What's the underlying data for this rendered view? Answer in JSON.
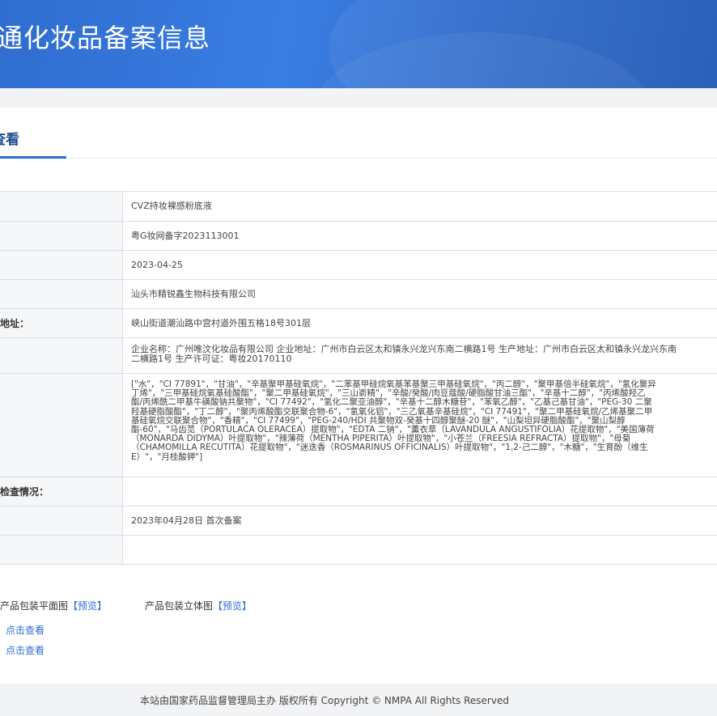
{
  "header": {
    "title": "通化妆品备案信息"
  },
  "tab": {
    "label": "查看"
  },
  "rows": [
    {
      "label": "",
      "value": "CVZ持妆裸感粉底液"
    },
    {
      "label": "",
      "value": "粤G妆网备字2023113001"
    },
    {
      "label": "",
      "value": "2023-04-25"
    },
    {
      "label": "",
      "value": "汕头市精锐鑫生物科技有限公司"
    },
    {
      "label": "地址：",
      "value": "峡山街道潮汕路中宫村道外围五格18号301层"
    },
    {
      "label": "",
      "value": "企业名称：广州唯汶化妆品有限公司 企业地址：广州市白云区太和镇永兴龙兴东南二横路1号 生产地址：广州市白云区太和镇永兴龙兴东南\n二横路1号 生产许可证：粤妆20170110"
    },
    {
      "label": "",
      "value": "[\"水\"，\"CI 77891\"，\"甘油\"，\"辛基聚甲基硅氧烷\"，\"二苯基甲硅烷氧基苯基聚三甲基硅氧烷\"，\"丙二醇\"，\"聚甲基倍半硅氧烷\"，\"氢化聚异\n丁烯\"，\"三甲基硅烷氧基硅酸酯\"，\"聚二甲基硅氧烷\"，\"三山嵛精\"，\"辛酸/癸酸/肉豆蔻酸/硬脂酸甘油三酯\"，\"辛基十二醇\"，\"丙烯酸羟乙\n酯/丙烯酰二甲基牛磺酸钠共聚物\"，\"CI 77492\"，\"氢化二聚亚油醇\"，\"辛基十二醇木糖苷\"，\"苯氧乙醇\"，\"乙基己基甘油\"，\"PEG-30 二聚\n羟基硬脂酸酯\"，\"丁二醇\"，\"聚丙烯酸酯交联聚合物-6\"，\"氢氧化铝\"，\"三乙氧基辛基硅烷\"，\"CI 77491\"，\"聚二甲基硅氧烷/乙烯基聚二甲\n基硅氧烷交联聚合物\"，\"香精\"，\"CI 77499\"，\"PEG-240/HDI 共聚物双-癸基十四醇聚醚-20 醚\"，\"山梨坦异硬脂酸酯\"，\"聚山梨醇\n酯-60\"，\"马齿苋（PORTULACA OLERACEA）提取物\"，\"EDTA 二钠\"，\"薰衣草（LAVANDULA ANGUSTIFOLIA）花提取物\"，\"美国薄荷\n（MONARDA DIDYMA）叶提取物\"，\"辣薄荷（MENTHA PIPERITA）叶提取物\"，\"小苍兰（FREESIA REFRACTA）提取物\"，\"母菊\n（CHAMOMILLA RECUTITA）花提取物\"，\"迷迭香（ROSMARINUS OFFICINALIS）叶提取物\"，\"1,2-己二醇\"，\"木糖\"，\"生育酚（维生\nE）\"，\"月桂酸钾\"]"
    },
    {
      "label": "检查情况：",
      "value": ""
    },
    {
      "label": "",
      "value": "2023年04月28日 首次备案"
    },
    {
      "label": "",
      "value": ""
    }
  ],
  "packaging": {
    "flat_label": "产品包装平面图",
    "flat_preview": "【预览】",
    "stereo_label": "产品包装立体图",
    "stereo_preview": "【预览】",
    "click_view_1": "点击查看",
    "click_view_2": "点击查看"
  },
  "footer": {
    "text": "本站由国家药品监督管理局主办 版权所有 Copyright © NMPA All Rights Reserved"
  },
  "colors": {
    "banner": "#3a7de2",
    "link": "#2a6fd6",
    "tab_text": "#1f4f8f"
  }
}
